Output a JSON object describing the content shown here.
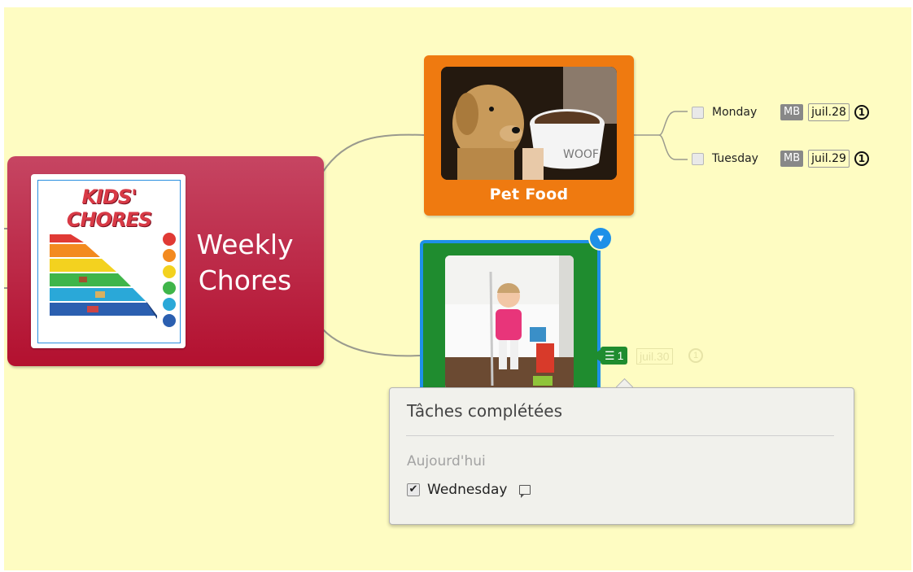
{
  "mindmap": {
    "central_topic": {
      "label_line1": "Weekly",
      "label_line2": "Chores",
      "image_title": "KIDS' CHORES",
      "color": "#b3102f"
    },
    "pet_food": {
      "label": "Pet Food",
      "color": "#ef7a10",
      "image_text": "WOOF",
      "tasks": [
        {
          "label": "Monday",
          "assignee": "MB",
          "date": "juil.28",
          "priority": "1"
        },
        {
          "label": "Tuesday",
          "assignee": "MB",
          "date": "juil.29",
          "priority": "1"
        }
      ]
    },
    "selected_topic": {
      "color": "#1f8c2f",
      "selection_color": "#1e90e8",
      "dropdown_icon": "triangle-down-icon",
      "task_badge_icon": "task-list-icon",
      "task_count": "1",
      "date": "juil.30",
      "priority": "1"
    }
  },
  "popup": {
    "title": "Tâches complétées",
    "section": "Aujourd'hui",
    "item_label": "Wednesday",
    "item_checkmark": "✔",
    "comment_icon": "comment-icon"
  },
  "icons": {
    "dropdown_glyph": "▼",
    "task_list_glyph": "☰"
  }
}
